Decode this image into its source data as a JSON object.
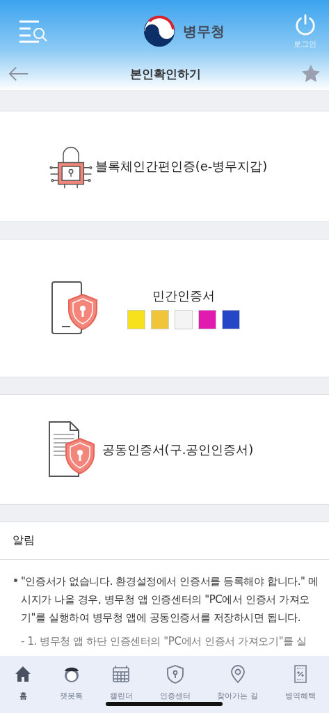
{
  "header": {
    "brand": "병무청",
    "login_label": "로그인"
  },
  "title_bar": {
    "title": "본인확인하기",
    "favorite": false
  },
  "auth_options": [
    {
      "kind": "blockchain",
      "label": "블록체인간편인증(e-병무지갑)"
    },
    {
      "kind": "private",
      "label": "민간인증서",
      "providers": [
        {
          "color": "#f7e01c"
        },
        {
          "color": "#f0c53a"
        },
        {
          "color": "#f4f4f4"
        },
        {
          "color": "#e21bb0"
        },
        {
          "color": "#2447c8"
        }
      ]
    },
    {
      "kind": "joint",
      "label": "공동인증서(구.공인인증서)"
    }
  ],
  "notice": {
    "title": "알림",
    "items": [
      {
        "kind": "bullet",
        "text": "\"인증서가 없습니다. 환경설정에서 인증서를 등록해야 합니다.\" 메시지가 나올 경우, 병무청 앱 인증센터의 \"PC에서 인증서 가져오기\"를 실행하여 병무청 앱에 공동인증서를 저장하시면 됩니다."
      },
      {
        "kind": "dash",
        "text": "- 1. 병무청 앱 하단 인증센터의 \"PC에서 인증서 가져오기\"를 실"
      }
    ]
  },
  "tab_bar": [
    {
      "kind": "home",
      "label": "홈",
      "selected": true
    },
    {
      "kind": "chatbot",
      "label": "챗봇톡",
      "selected": false
    },
    {
      "kind": "calendar",
      "label": "캘린더",
      "selected": false
    },
    {
      "kind": "cert",
      "label": "인증센터",
      "selected": false
    },
    {
      "kind": "map",
      "label": "찾아가는 길",
      "selected": false
    },
    {
      "kind": "benefit",
      "label": "병역혜택",
      "selected": false
    }
  ]
}
